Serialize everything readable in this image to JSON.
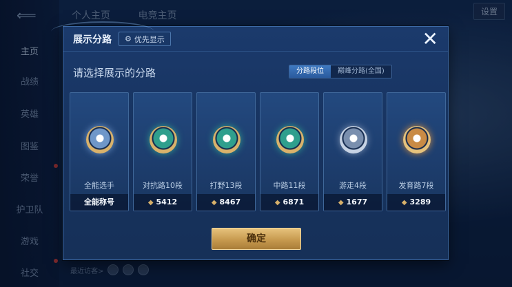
{
  "background": {
    "back_glyph": "⟸",
    "sidebar": [
      "主页",
      "战绩",
      "英雄",
      "图鉴",
      "荣誉",
      "护卫队",
      "游戏",
      "社交"
    ],
    "top_tabs": [
      "个人主页",
      "电竞主页"
    ],
    "settings_label": "设置",
    "visitors_label": "最近访客>"
  },
  "modal": {
    "title": "展示分路",
    "priority_label": "优先显示",
    "close_glyph": "✕",
    "prompt": "请选择展示的分路",
    "segment": {
      "option1": "分路段位",
      "option2": "巅峰分路(全国)"
    },
    "cards": [
      {
        "label": "全能选手",
        "value": "全能称号",
        "icon": "all-rounder-icon",
        "color": "#6f97c9",
        "rim": "#d9b26b",
        "show_diamond": false
      },
      {
        "label": "对抗路10段",
        "value": "5412",
        "icon": "clash-lane-icon",
        "color": "#2f9f8d",
        "rim": "#d9b26b",
        "show_diamond": true
      },
      {
        "label": "打野13段",
        "value": "8467",
        "icon": "jungle-icon",
        "color": "#2f9f8d",
        "rim": "#d9b26b",
        "show_diamond": true
      },
      {
        "label": "中路11段",
        "value": "6871",
        "icon": "mid-lane-icon",
        "color": "#2f9f8d",
        "rim": "#d9b26b",
        "show_diamond": true
      },
      {
        "label": "游走4段",
        "value": "1677",
        "icon": "roam-icon",
        "color": "#7a8fae",
        "rim": "#c7d3e4",
        "show_diamond": true
      },
      {
        "label": "发育路7段",
        "value": "3289",
        "icon": "farm-lane-icon",
        "color": "#c98b45",
        "rim": "#e6c27c",
        "show_diamond": true
      }
    ],
    "confirm_label": "确定"
  }
}
